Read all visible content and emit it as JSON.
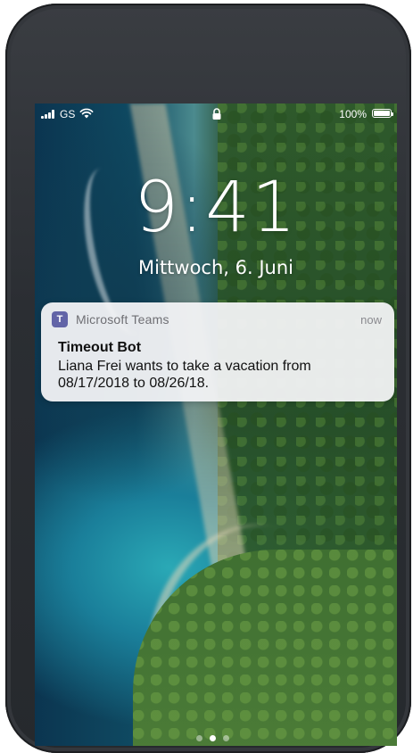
{
  "status_bar": {
    "carrier": "GS",
    "battery_percent": "100%",
    "battery_level": 1.0,
    "icons": [
      "signal-icon",
      "wifi-icon",
      "lock-icon",
      "battery-icon"
    ]
  },
  "lock_screen": {
    "time": "9:41",
    "date": "Mittwoch, 6. Juni"
  },
  "notification": {
    "app_icon_glyph": "T",
    "app_name": "Microsoft Teams",
    "time": "now",
    "title": "Timeout Bot",
    "body": "Liana Frei wants to take a vacation from 08/17/2018 to 08/26/18.",
    "accent_color": "#6264a7"
  },
  "page_indicator": {
    "count": 3,
    "active_index": 1
  }
}
